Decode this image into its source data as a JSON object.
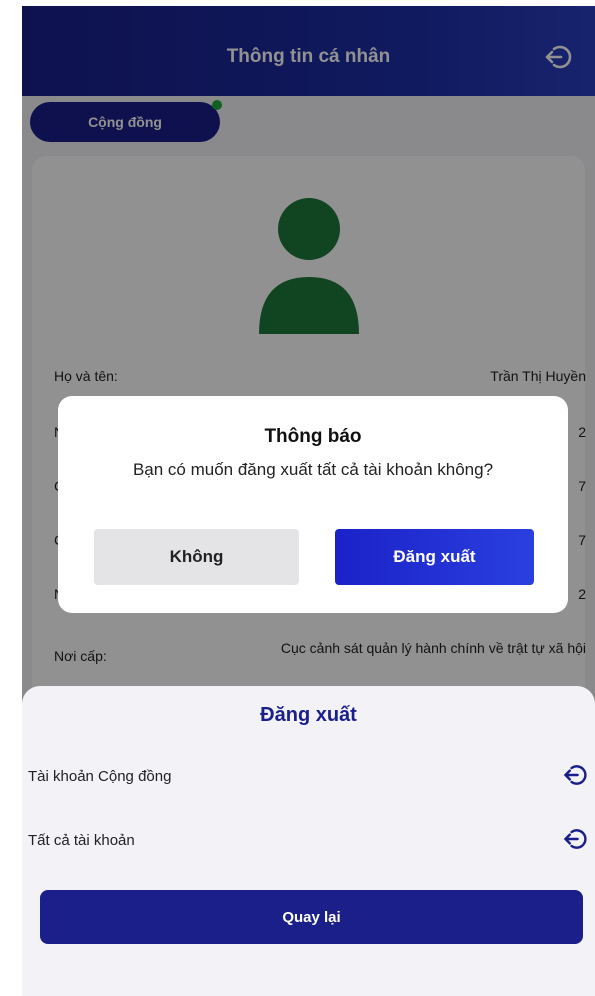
{
  "header": {
    "title": "Thông tin cá nhân",
    "logout_icon": "logout-icon"
  },
  "tabs": [
    {
      "label": "Cộng đồng",
      "active": true
    }
  ],
  "profile": {
    "rows": [
      {
        "label": "Họ và tên:",
        "value": "Trần Thị Huyền"
      },
      {
        "label": "N",
        "value": "2"
      },
      {
        "label": "C",
        "value": "7"
      },
      {
        "label": "C",
        "value": "7"
      },
      {
        "label": "N",
        "value": "2"
      },
      {
        "label": "Nơi cấp:",
        "value": "Cục cảnh sát quản lý hành chính về trật tự xã hội"
      }
    ]
  },
  "modal": {
    "title": "Thông báo",
    "message": "Bạn có muốn đăng xuất tất cả tài khoản không?",
    "cancel_label": "Không",
    "confirm_label": "Đăng xuất"
  },
  "sheet": {
    "title": "Đăng xuất",
    "items": [
      {
        "label": "Tài khoản Cộng đồng",
        "icon": "logout-icon"
      },
      {
        "label": "Tất cả tài khoản",
        "icon": "logout-icon"
      }
    ],
    "back_label": "Quay lại"
  },
  "colors": {
    "primary": "#1a1f8a",
    "accent_green": "#1e7a3a",
    "confirm": "#1a22c8"
  }
}
